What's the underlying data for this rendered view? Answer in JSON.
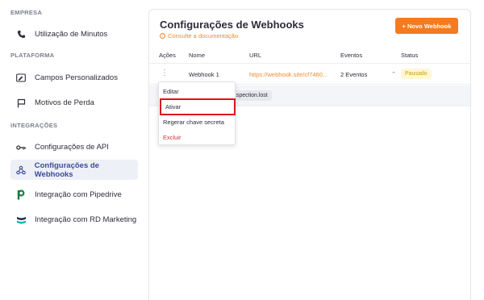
{
  "sidebar": {
    "sections": [
      {
        "title": "EMPRESA"
      },
      {
        "title": "PLATAFORMA"
      },
      {
        "title": "INTEGRAÇÕES"
      }
    ],
    "items": [
      {
        "label": "Utilização de Minutos",
        "icon": "phone-icon"
      },
      {
        "label": "Campos Personalizados",
        "icon": "form-icon"
      },
      {
        "label": "Motivos de Perda",
        "icon": "flag-icon"
      },
      {
        "label": "Configurações de API",
        "icon": "key-icon"
      },
      {
        "label": "Configurações de Webhooks",
        "icon": "webhook-icon",
        "active": true
      },
      {
        "label": "Integração com Pipedrive",
        "icon": "pipedrive-icon"
      },
      {
        "label": "Integração com RD Marketing",
        "icon": "rd-icon"
      }
    ]
  },
  "main": {
    "title": "Configurações de Webhooks",
    "doc_link": "Consulte a documentação",
    "new_button": "+ Novo Webhook",
    "columns": [
      "Ações",
      "Nome",
      "URL",
      "Eventos",
      "Status"
    ],
    "rows": [
      {
        "actions": "⋮",
        "name": "Webhook 1",
        "url": "https://webhook.site/cf7460...",
        "events": "2 Eventos",
        "status": "Pausado",
        "tag": "...spection.lost"
      }
    ]
  },
  "menu": {
    "items": [
      "Editar",
      "Ativar",
      "Regerar chave secreta",
      "Excluir"
    ]
  },
  "colors": {
    "accent": "#f47b20",
    "active_nav": "#3b4a9c",
    "danger": "#d0313b",
    "highlight_box": "#d8161f",
    "status_paused": "#c9a100"
  }
}
